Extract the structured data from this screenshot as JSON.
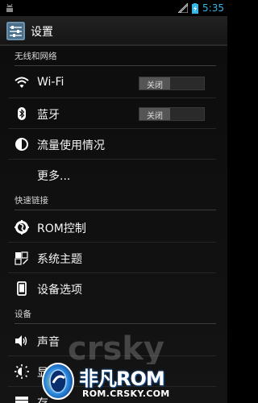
{
  "statusbar": {
    "time": "5:35",
    "icons": [
      "android-icon",
      "signal-icon",
      "battery-charging-icon"
    ]
  },
  "actionbar": {
    "title": "设置",
    "icon": "settings-app-icon"
  },
  "sections": {
    "wireless": {
      "title": "无线和网络",
      "items": {
        "wifi": {
          "label": "Wi-Fi",
          "icon": "wifi-icon",
          "toggle": "关闭"
        },
        "bluetooth": {
          "label": "蓝牙",
          "icon": "bluetooth-icon",
          "toggle": "关闭"
        },
        "data_usage": {
          "label": "流量使用情况",
          "icon": "data-usage-icon"
        },
        "more": {
          "label": "更多..."
        }
      }
    },
    "shortcuts": {
      "title": "快速链接",
      "items": {
        "rom_control": {
          "label": "ROM控制",
          "icon": "rom-control-icon"
        },
        "theme": {
          "label": "系统主题",
          "icon": "theme-icon"
        },
        "device_options": {
          "label": "设备选项",
          "icon": "phone-icon"
        }
      }
    },
    "device": {
      "title": "设备",
      "items": {
        "sound": {
          "label": "声音",
          "icon": "speaker-icon"
        },
        "display": {
          "label": "显",
          "icon": "brightness-icon"
        },
        "storage": {
          "label": "存",
          "icon": "storage-icon"
        }
      }
    }
  },
  "watermark": {
    "brand": "非凡ROM",
    "url": "ROM.CRSKY.COM",
    "ghost_text": "crsky"
  },
  "colors": {
    "accent": "#33b5e5",
    "background": "#111111",
    "divider": "#3d3d3d"
  }
}
